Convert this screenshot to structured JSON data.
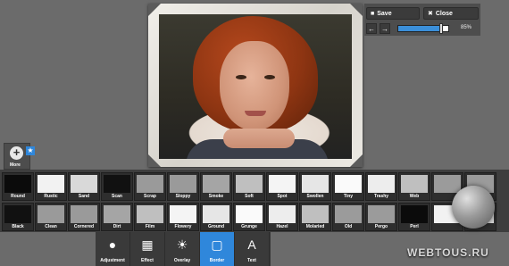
{
  "header": {
    "save_label": "Save",
    "close_label": "Close",
    "back_icon": "arrow-left-icon",
    "forward_icon": "arrow-right-icon",
    "zoom": {
      "value_label": "85%",
      "fraction": 0.85
    }
  },
  "more": {
    "label": "More",
    "badge_icon": "star-icon"
  },
  "thumbnails": {
    "row1": [
      "Round",
      "Rustic",
      "Sand",
      "Scan",
      "Scrap",
      "Sloppy",
      "Smoke",
      "Soft",
      "Spot",
      "Swollen",
      "Tiny",
      "Trashy",
      "Web",
      "",
      ""
    ],
    "row2": [
      "Black",
      "Clean",
      "Cornered",
      "Dirt",
      "Film",
      "Flowery",
      "Ground",
      "Grunge",
      "Hazel",
      "Molaried",
      "Old",
      "Pergo",
      "Perl",
      "",
      ""
    ]
  },
  "toolbar": {
    "items": [
      {
        "label": "Adjustment",
        "icon": "circles-icon",
        "active": false
      },
      {
        "label": "Effect",
        "icon": "film-icon",
        "active": false
      },
      {
        "label": "Overlay",
        "icon": "lightbulb-icon",
        "active": false
      },
      {
        "label": "Border",
        "icon": "frame-icon",
        "active": true
      },
      {
        "label": "Text",
        "icon": "text-icon",
        "active": false
      }
    ]
  },
  "watermark": {
    "text": "WEBTOUS.RU"
  },
  "colors": {
    "accent": "#2f87db",
    "background": "#6b6b6b",
    "panel": "#3e3e3e"
  }
}
